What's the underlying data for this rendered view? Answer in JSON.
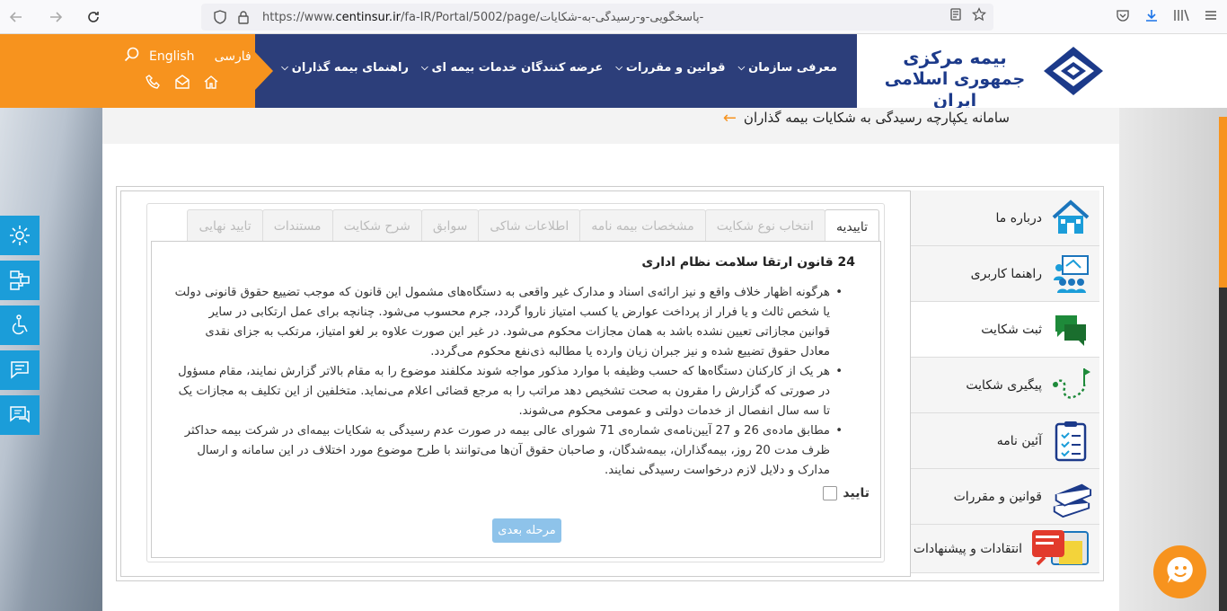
{
  "browser": {
    "url_prefix": "https://www.",
    "url_host": "centinsur.ir",
    "url_path": "/fa-IR/Portal/5002/page/پاسخگویی-و-رسیدگی-به-شکایات-"
  },
  "header": {
    "lang_en": "English",
    "lang_fa": "فارسی",
    "logo_line1": "بیمه مرکزی",
    "logo_line2": "جمهوری اسلامی ایران",
    "nav": [
      {
        "label": "معرفی سازمان"
      },
      {
        "label": "قوانین و مقررات"
      },
      {
        "label": "عرضه کنندگان خدمات بیمه ای"
      },
      {
        "label": "راهنمای بیمه گذاران"
      }
    ]
  },
  "breadcrumb": {
    "title": "سامانه یکپارچه رسیدگی به شکایات بیمه گذاران"
  },
  "right_menu": [
    {
      "label": "درباره ما",
      "icon": "home-icon"
    },
    {
      "label": "راهنما کاربری",
      "icon": "training-icon"
    },
    {
      "label": "ثبت شکایت",
      "icon": "chat-bubbles-icon"
    },
    {
      "label": "پیگیری شکایت",
      "icon": "route-flag-icon"
    },
    {
      "label": "آئین نامه",
      "icon": "checklist-icon"
    },
    {
      "label": "قوانین و مقررات",
      "icon": "books-icon"
    },
    {
      "label": "انتقادات و پیشنهادات",
      "icon": "suggestion-box-icon"
    }
  ],
  "tabs": [
    {
      "label": "تاییدیه",
      "active": true
    },
    {
      "label": "انتخاب نوع شکایت"
    },
    {
      "label": "مشخصات بیمه نامه"
    },
    {
      "label": "اطلاعات شاکی"
    },
    {
      "label": "سوابق"
    },
    {
      "label": "شرح شکایت"
    },
    {
      "label": "مستندات"
    },
    {
      "label": "تایید نهایی"
    }
  ],
  "body": {
    "title": "24 قانون ارتقا سلامت نظام اداری",
    "bullets": [
      "هرگونه اظهار خلاف واقع و نیز ارائه‌ی اسناد و مدارک غیر واقعی به دستگاه‌های مشمول این قانون که موجب تضییع حقوق قانونی دولت یا شخص ثالث و یا فرار از پرداخت عوارض یا کسب امتیاز ناروا گردد، جرم محسوب می‌شود. چنانچه برای عمل ارتکابی در سایر قوانین مجازاتی تعیین نشده باشد به همان مجازات محکوم می‌شود. در غیر این صورت علاوه بر لغو امتیاز، مرتکب به جزای نقدی معادل حقوق تضییع شده و نیز جبران زیان وارده یا مطالبه ذی‌نفع محکوم می‌گردد.",
      "هر یک از کارکنان دستگاه‌ها که حسب وظیفه با موارد مذکور مواجه شوند مکلفند موضوع را به مقام بالاتر گزارش نمایند، مقام مسؤول در صورتی که گزارش را مقرون به صحت تشخیص دهد مراتب را به مرجع قضائی اعلام می‌نماید. متخلفین از این تکلیف به مجازات یک تا سه سال انفصال از خدمات دولتی و عمومی محکوم می‌شوند.",
      "مطابق ماده‌ی 26 و 27 آیین‌نامه‌ی شماره‌ی 71 شورای عالی بیمه در صورت عدم رسیدگی به شکایات بیمه‌ای در شرکت بیمه حداکثر ظرف مدت 20 روز، بیمه‌گذاران، بیمه‌شدگان، و صاحبان حقوق آن‌ها می‌توانند با طرح موضوع مورد اختلاف در این سامانه و ارسال مدارک و دلایل لازم درخواست رسیدگی نمایند."
    ],
    "confirm_label": "تایید",
    "next_button": "مرحله بعدی"
  },
  "colors": {
    "orange": "#f7931e",
    "navy": "#2c3e7a",
    "side_blue": "#1b9dd9",
    "button_blue": "#8ec3ea"
  }
}
